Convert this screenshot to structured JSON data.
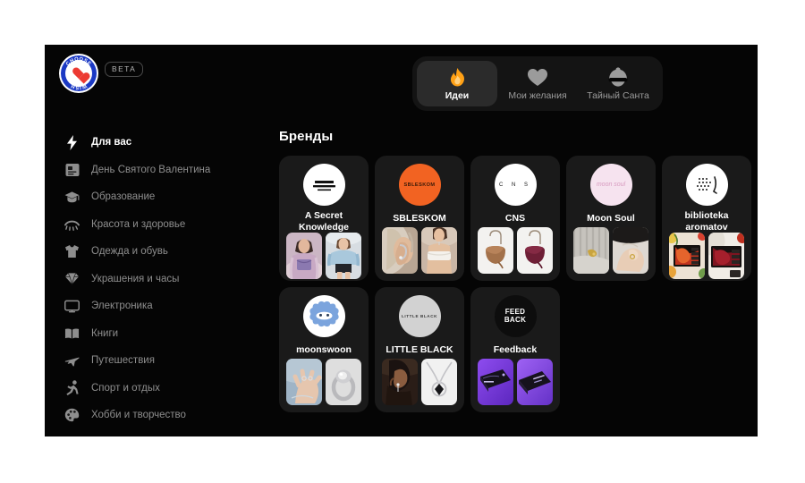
{
  "header": {
    "logo": {
      "icon": "heart-logo-icon",
      "ring_text_top": "CHOOSE",
      "ring_text_bottom": "WISH"
    },
    "beta_badge": "BETA",
    "tabs": [
      {
        "label": "Идеи",
        "icon": "flame-icon",
        "active": true
      },
      {
        "label": "Мои желания",
        "icon": "heart-icon",
        "active": false
      },
      {
        "label": "Тайный Санта",
        "icon": "santa-hat-icon",
        "active": false
      }
    ]
  },
  "sidebar": {
    "items": [
      {
        "label": "Для вас",
        "icon": "lightning-bolt-icon",
        "active": true
      },
      {
        "label": "День Святого Валентина",
        "icon": "card-icon",
        "active": false
      },
      {
        "label": "Образование",
        "icon": "graduation-cap-icon",
        "active": false
      },
      {
        "label": "Красота и здоровье",
        "icon": "eyelash-icon",
        "active": false
      },
      {
        "label": "Одежда и обувь",
        "icon": "tshirt-icon",
        "active": false
      },
      {
        "label": "Украшения и часы",
        "icon": "gem-icon",
        "active": false
      },
      {
        "label": "Электроника",
        "icon": "monitor-icon",
        "active": false
      },
      {
        "label": "Книги",
        "icon": "book-icon",
        "active": false
      },
      {
        "label": "Путешествия",
        "icon": "airplane-icon",
        "active": false
      },
      {
        "label": "Спорт и отдых",
        "icon": "runner-icon",
        "active": false
      },
      {
        "label": "Хобби и творчество",
        "icon": "palette-icon",
        "active": false
      }
    ]
  },
  "main": {
    "section_title": "Бренды",
    "brands": [
      {
        "name": "A Secret Knowledge",
        "logo_bg": "#ffffff",
        "logo_text": "A SECRET KNOWLEDGE",
        "logo_text_color": "#111111",
        "thumbs": [
          {
            "bg": "#d8c4cc",
            "subject": "woman-in-lilac-top"
          },
          {
            "bg": "#c9d8e0",
            "subject": "woman-in-blue-hoodie"
          }
        ]
      },
      {
        "name": "SBLESKOM",
        "logo_bg": "#f26322",
        "logo_text": "SBLESKOM",
        "logo_text_color": "#3a1a08",
        "thumbs": [
          {
            "bg": "#cbb7a6",
            "subject": "ear-cuff-jewelry"
          },
          {
            "bg": "#d6c3b4",
            "subject": "woman-in-white-top"
          }
        ]
      },
      {
        "name": "CNS",
        "logo_bg": "#ffffff",
        "logo_text": "C N S",
        "logo_text_color": "#111111",
        "thumbs": [
          {
            "bg": "#f2f2f2",
            "subject": "brown-handbag"
          },
          {
            "bg": "#f2f2f2",
            "subject": "burgundy-handbag"
          }
        ]
      },
      {
        "name": "Moon Soul",
        "logo_bg": "#f6e3ef",
        "logo_text": "moon soul",
        "logo_text_color": "#d89cc0",
        "thumbs": [
          {
            "bg": "#c9c6c1",
            "subject": "gold-pin-on-knit"
          },
          {
            "bg": "#d9d4cf",
            "subject": "hand-with-ring"
          }
        ]
      },
      {
        "name": "biblioteka aromatov",
        "logo_bg": "#ffffff",
        "logo_text": "dots-leaf",
        "logo_text_color": "#111111",
        "thumbs": [
          {
            "bg": "#e8d9c8",
            "subject": "perfume-flowers-collage"
          },
          {
            "bg": "#e3d2c6",
            "subject": "perfume-red-collage"
          }
        ]
      },
      {
        "name": "moonswoon",
        "logo_bg": "#ffffff",
        "logo_text": "cloud-face",
        "logo_text_color": "#6f9ad8",
        "thumbs": [
          {
            "bg": "#9eb3c6",
            "subject": "hand-with-jewelry"
          },
          {
            "bg": "#d9d9d9",
            "subject": "silver-ring"
          }
        ]
      },
      {
        "name": "LITTLE BLACK",
        "logo_bg": "#d2d2d2",
        "logo_text": "LITTLE BLACK",
        "logo_text_color": "#3a3a3a",
        "thumbs": [
          {
            "bg": "#3a2a22",
            "subject": "woman-profile-earring"
          },
          {
            "bg": "#f0f0f0",
            "subject": "silver-necklace"
          }
        ]
      },
      {
        "name": "Feedback",
        "logo_bg": "#0d0d0d",
        "logo_text": "FEED BACK",
        "logo_text_color": "#ffffff",
        "thumbs": [
          {
            "bg": "#7b3fe4",
            "subject": "dark-card-purple-bg"
          },
          {
            "bg": "#7b3fe4",
            "subject": "dark-card-purple-bg-2"
          }
        ]
      }
    ]
  },
  "colors": {
    "app_bg": "#050505",
    "card_bg": "#1a1a1a",
    "tabbar_bg": "#141414",
    "active_tab_bg": "#2b2b2b",
    "accent_orange": "#ffa116",
    "text_primary": "#ffffff",
    "text_muted": "#8e8e8e",
    "logo_blue": "#1b39c4",
    "logo_heart_red": "#ec3a32"
  }
}
